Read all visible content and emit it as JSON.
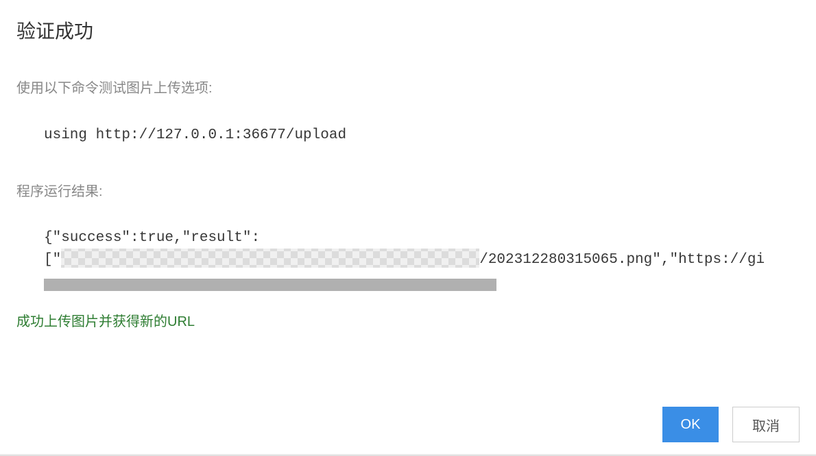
{
  "dialog": {
    "title": "验证成功",
    "instruction_label": "使用以下命令测试图片上传选项:",
    "command_text": "using http://127.0.0.1:36677/upload",
    "result_label": "程序运行结果:",
    "result_line1": "{\"success\":true,\"result\":",
    "result_line2_prefix": "[\"",
    "result_line2_suffix": "/202312280315065.png\",\"https://gi",
    "success_message": "成功上传图片并获得新的URL",
    "buttons": {
      "ok": "OK",
      "cancel": "取消"
    }
  }
}
